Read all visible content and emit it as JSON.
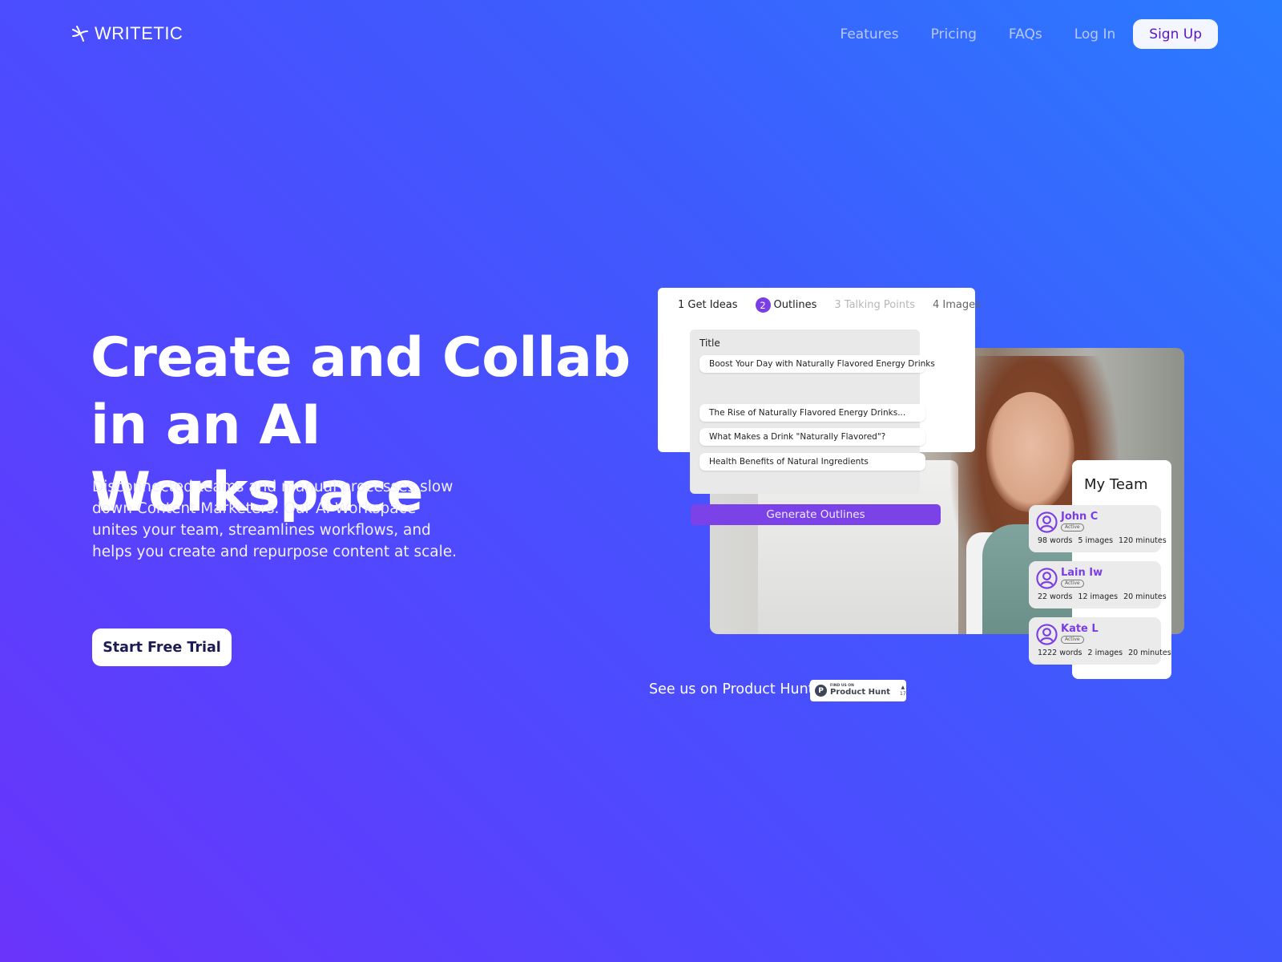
{
  "brand": {
    "name": "WRITETIC",
    "logo_icon": "sparkle-pinwheel-icon"
  },
  "nav": {
    "links": [
      {
        "label": "Features"
      },
      {
        "label": "Pricing"
      },
      {
        "label": "FAQs"
      },
      {
        "label": "Log In"
      }
    ],
    "signup_label": "Sign Up"
  },
  "hero": {
    "title_line1": "Create and Collab",
    "title_line2": "in an AI Workspace",
    "description": "Disconnected teams and manual processes slow down Content Marketers. Our AI Workspace unites your team, streamlines workflows, and helps you create and repurpose content at scale.",
    "cta_label": "Start Free Trial"
  },
  "mockup": {
    "steps": [
      {
        "num": "1",
        "label": "Get Ideas",
        "state": "done"
      },
      {
        "num": "2",
        "label": "Outlines",
        "state": "active"
      },
      {
        "num": "3",
        "label": "Talking Points",
        "state": "disabled"
      },
      {
        "num": "4",
        "label": "Images",
        "state": "pending"
      }
    ],
    "title_label": "Title",
    "title_value": "Boost Your Day with Naturally Flavored Energy Drinks",
    "outline_items": [
      "The Rise of Naturally Flavored Energy Drinks...",
      "What Makes a Drink \"Naturally Flavored\"?",
      "Health Benefits of Natural Ingredients"
    ],
    "generate_label": "Generate Outlines",
    "team": {
      "title": "My Team",
      "members": [
        {
          "name": "John C",
          "status": "Active",
          "words": "98 words",
          "images": "5 images",
          "minutes": "120 minutes"
        },
        {
          "name": "Lain Iw",
          "status": "Active",
          "words": "22 words",
          "images": "12 images",
          "minutes": "20 minutes"
        },
        {
          "name": "Kate L",
          "status": "Active",
          "words": "1222 words",
          "images": "2 images",
          "minutes": "20 minutes"
        }
      ]
    }
  },
  "product_hunt": {
    "text": "See us on Product Hunt",
    "badge_small": "FIND US ON",
    "badge_name": "Product Hunt",
    "badge_letter": "P",
    "upvote_arrow": "▲",
    "upvotes": "17"
  },
  "colors": {
    "accent_purple": "#7a3de6",
    "signup_text": "#5b14c9",
    "gradient_start": "#6a34fb",
    "gradient_end": "#2a7cff"
  }
}
